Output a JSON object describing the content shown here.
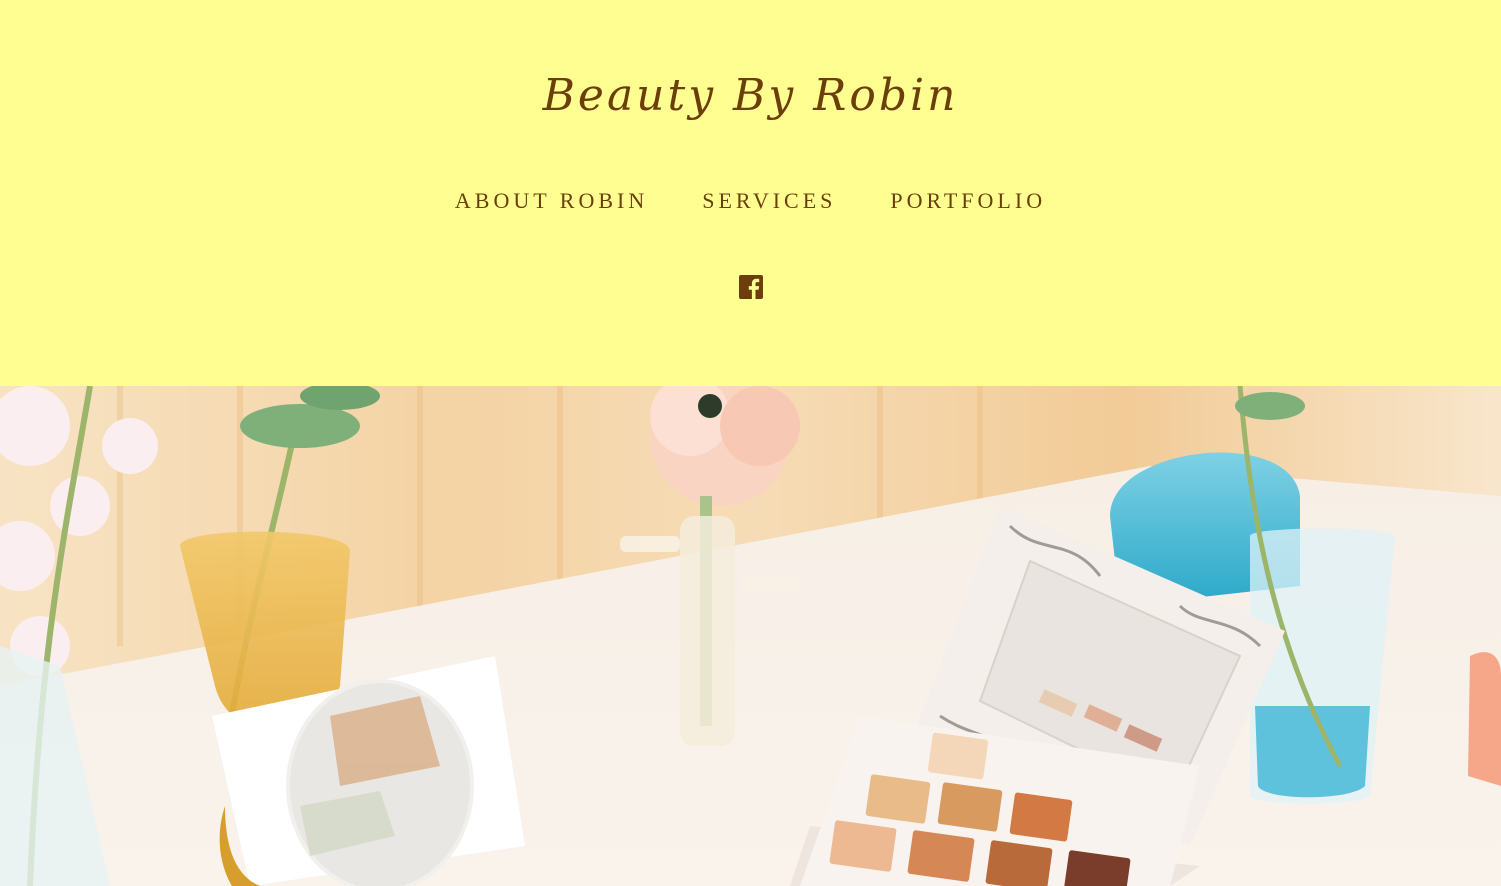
{
  "site": {
    "title": "Beauty By Robin"
  },
  "nav": {
    "items": [
      {
        "label": "ABOUT ROBIN"
      },
      {
        "label": "SERVICES"
      },
      {
        "label": "PORTFOLIO"
      }
    ]
  },
  "social": {
    "icon": "facebook-icon"
  },
  "hero": {
    "description_icon": "makeup-palette-photo"
  },
  "colors": {
    "header_bg": "#ffff91",
    "text": "#6b3e0b"
  }
}
